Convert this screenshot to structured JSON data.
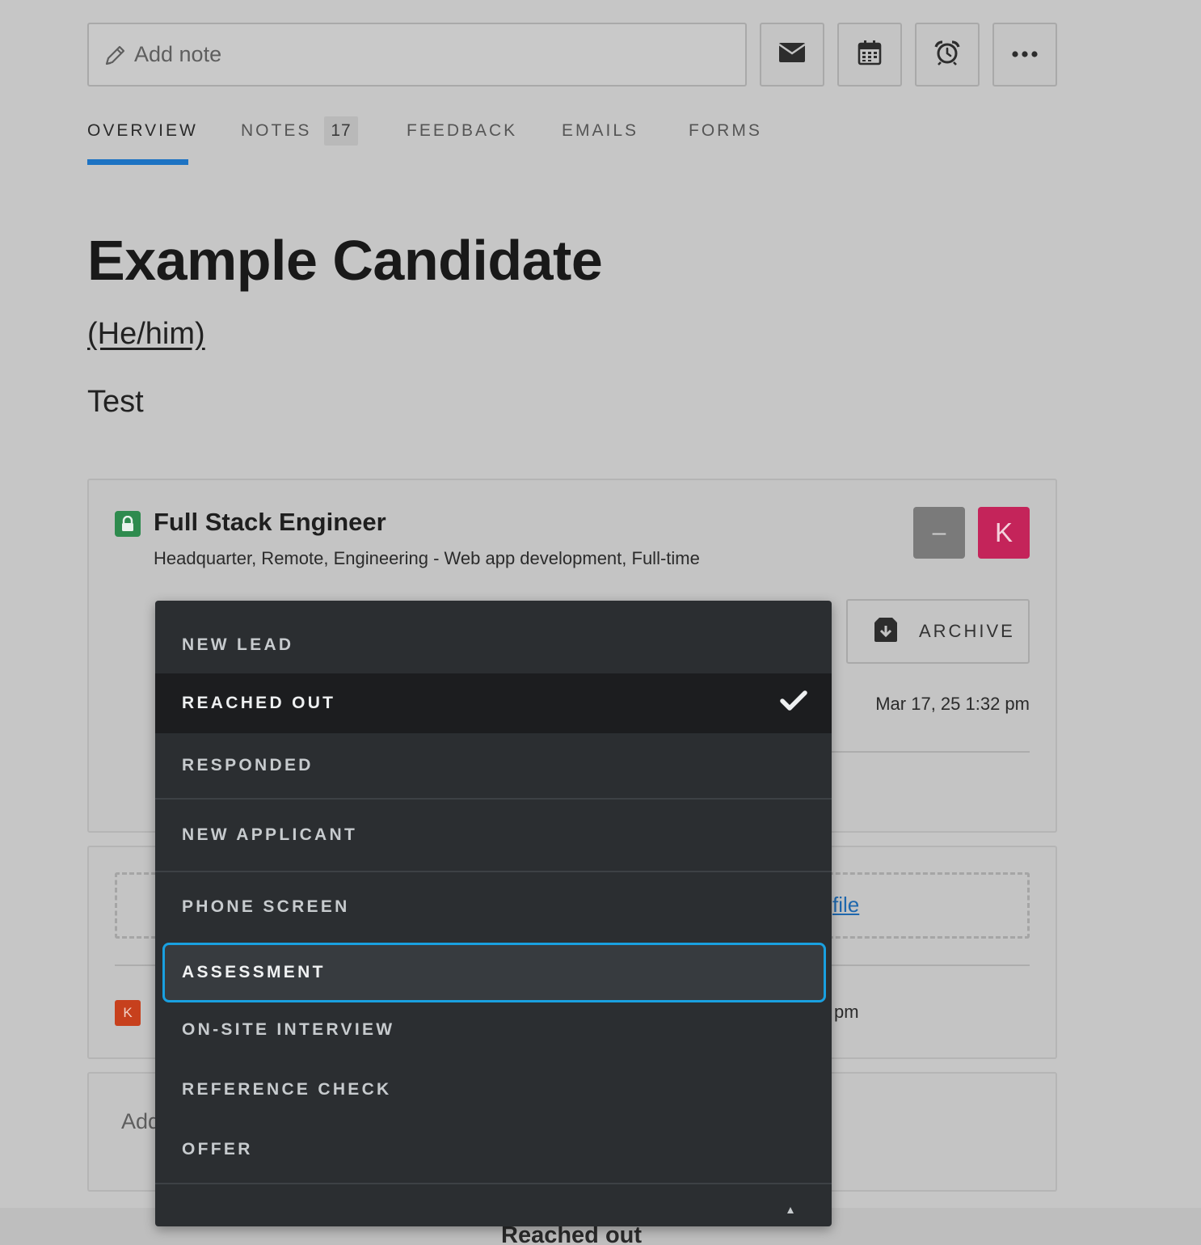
{
  "note_bar": {
    "placeholder": "Add note"
  },
  "toolbar": {
    "email_icon": "envelope-icon",
    "calendar_icon": "calendar-icon",
    "reminder_icon": "alarm-clock-icon",
    "more_icon": "ellipsis-icon"
  },
  "tabs": [
    {
      "label": "OVERVIEW",
      "active": true
    },
    {
      "label": "NOTES",
      "count": "17"
    },
    {
      "label": "FEEDBACK"
    },
    {
      "label": "EMAILS"
    },
    {
      "label": "FORMS"
    }
  ],
  "candidate": {
    "name": "Example Candidate",
    "pronouns": "(He/him)",
    "headline": "Test"
  },
  "opportunity": {
    "title": "Full Stack Engineer",
    "meta": "Headquarter, Remote, Engineering - Web app development, Full-time",
    "avatar_initial": "K",
    "archive_label": "ARCHIVE",
    "stage_date": "Mar 17, 25 1:32 pm"
  },
  "files": {
    "link_fragment": "file"
  },
  "activity": {
    "avatar_initial": "K",
    "time_fragment": "pm"
  },
  "add_fragment": "Add",
  "bottom": {
    "stage_label": "Reached out"
  },
  "stage_dropdown": {
    "options": [
      "NEW LEAD",
      "REACHED OUT",
      "RESPONDED",
      "NEW APPLICANT",
      "PHONE SCREEN",
      "ASSESSMENT",
      "ON-SITE INTERVIEW",
      "REFERENCE CHECK",
      "OFFER"
    ],
    "selected": "REACHED OUT",
    "focused": "ASSESSMENT"
  },
  "colors": {
    "tab_accent": "#1d73c3",
    "focus_ring": "#19a0e0",
    "lock_green": "#2e8b4e",
    "avatar_pink": "#c4245a",
    "avatar_orange": "#c7401d",
    "link_blue": "#1e67ad"
  }
}
